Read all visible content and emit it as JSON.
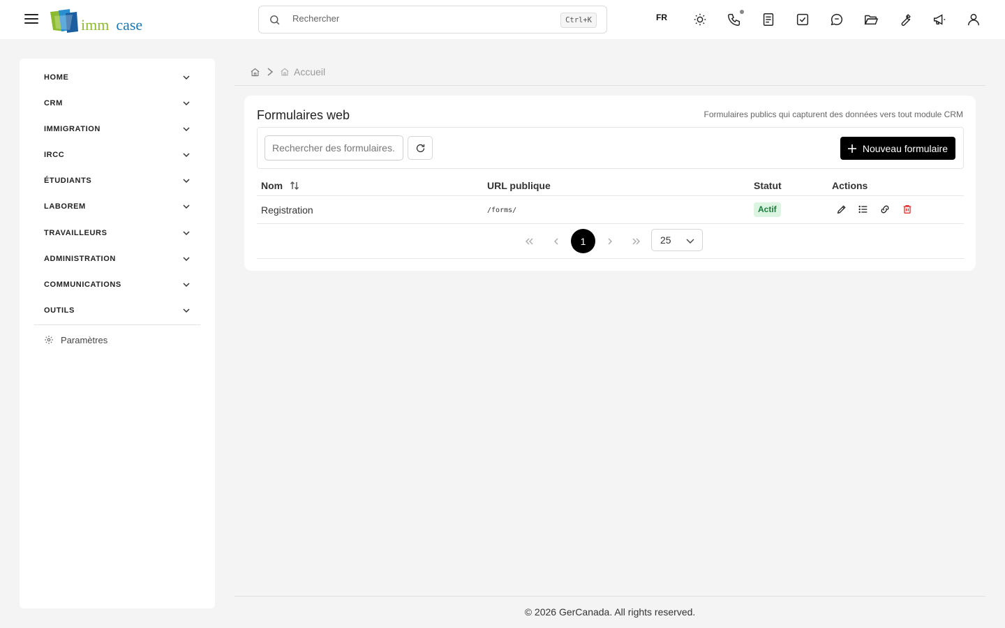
{
  "header": {
    "logo_part1": "imm",
    "logo_part2": "case",
    "search_placeholder": "Rechercher",
    "search_shortcut": "Ctrl+K",
    "language": "FR",
    "icons": [
      "sun-icon",
      "phone-icon",
      "notes-icon",
      "tasks-icon",
      "chat-icon",
      "folder-icon",
      "wrench-icon",
      "megaphone-icon",
      "user-icon"
    ]
  },
  "sidebar": {
    "items": [
      {
        "label": "HOME"
      },
      {
        "label": "CRM"
      },
      {
        "label": "IMMIGRATION"
      },
      {
        "label": "IRCC"
      },
      {
        "label": "ÉTUDIANTS"
      },
      {
        "label": "LABOREM"
      },
      {
        "label": "TRAVAILLEURS"
      },
      {
        "label": "ADMINISTRATION"
      },
      {
        "label": "COMMUNICATIONS"
      },
      {
        "label": "OUTILS"
      }
    ],
    "settings_label": "Paramètres"
  },
  "breadcrumb": {
    "current": "Accueil"
  },
  "card": {
    "title": "Formulaires web",
    "subtitle": "Formulaires publics qui capturent des données vers tout module CRM",
    "filter_placeholder": "Rechercher des formulaires...",
    "new_button": "Nouveau formulaire",
    "columns": {
      "name": "Nom",
      "url": "URL publique",
      "status": "Statut",
      "actions": "Actions"
    },
    "rows": [
      {
        "name": "Registration",
        "url": "/forms/",
        "status": "Actif"
      }
    ],
    "pagination": {
      "current_page": "1",
      "page_size": "25"
    }
  },
  "footer": {
    "text": "© 2026 GerCanada. All rights reserved."
  },
  "colors": {
    "accent_black": "#000000",
    "status_active_bg": "#dcf5e3",
    "status_active_text": "#1a7a3a",
    "delete_red": "#e03131",
    "logo_green": "#8dbb2f",
    "logo_blue": "#1b78b8"
  }
}
